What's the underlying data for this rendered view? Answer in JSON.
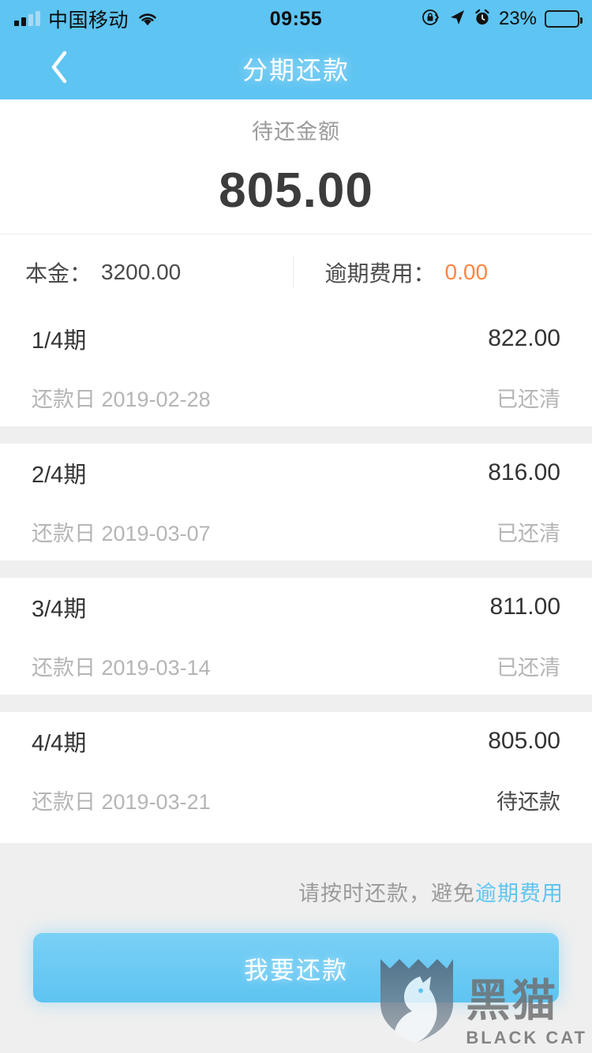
{
  "status_bar": {
    "carrier": "中国移动",
    "time": "09:55",
    "battery_percent": "23%",
    "icons": [
      "signal-bars-icon",
      "wifi-icon",
      "rotation-lock-icon",
      "location-arrow-icon",
      "alarm-clock-icon",
      "battery-icon"
    ]
  },
  "header": {
    "title": "分期还款",
    "back_icon": "chevron-left-icon",
    "background_color": "#5ec4f2"
  },
  "summary": {
    "label": "待还金额",
    "amount": "805.00"
  },
  "stats": [
    {
      "label": "本金：",
      "value": "3200.00",
      "value_color": "#4a4a4a"
    },
    {
      "label": "逾期费用：",
      "value": "0.00",
      "value_color": "#ff8642"
    }
  ],
  "installments": [
    {
      "term": "1/4期",
      "amount": "822.00",
      "due_label": "还款日 2019-02-28",
      "status": "已还清",
      "paid": true
    },
    {
      "term": "2/4期",
      "amount": "816.00",
      "due_label": "还款日 2019-03-07",
      "status": "已还清",
      "paid": true
    },
    {
      "term": "3/4期",
      "amount": "811.00",
      "due_label": "还款日 2019-03-14",
      "status": "已还清",
      "paid": true
    },
    {
      "term": "4/4期",
      "amount": "805.00",
      "due_label": "还款日 2019-03-21",
      "status": "待还款",
      "paid": false
    }
  ],
  "footer": {
    "tip_prefix": "请按时还款，避免",
    "tip_highlight": "逾期费用",
    "tip_highlight_color": "#5ec4f2",
    "pay_button": "我要还款"
  },
  "watermark": {
    "cn": "黑猫",
    "en": "BLACK CAT",
    "logo_icon": "cat-shield-logo-icon"
  }
}
